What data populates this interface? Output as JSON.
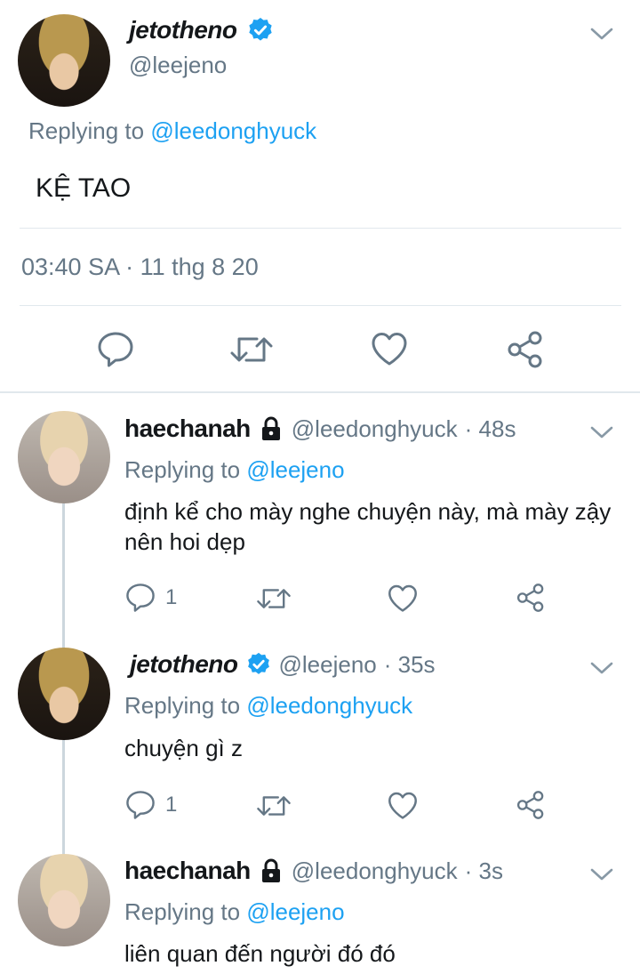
{
  "main_tweet": {
    "display_name": "jetotheno",
    "handle": "@leejeno",
    "replying_prefix": "Replying to",
    "replying_to": "@leedonghyuck",
    "text": "KỆ TAO",
    "timestamp": "03:40 SA · 11 thg 8 20"
  },
  "replies": [
    {
      "display_name": "haechanah",
      "handle": "@leedonghyuck",
      "time": "· 48s",
      "replying_prefix": "Replying to",
      "replying_to": "@leejeno",
      "text": "định kể cho mày nghe chuyện này, mà mày zậy nên hoi dẹp",
      "reply_count": "1"
    },
    {
      "display_name": "jetotheno",
      "handle": "@leejeno",
      "time": "· 35s",
      "replying_prefix": "Replying to",
      "replying_to": "@leedonghyuck",
      "text": "chuyện gì z",
      "reply_count": "1"
    },
    {
      "display_name": "haechanah",
      "handle": "@leedonghyuck",
      "time": "· 3s",
      "replying_prefix": "Replying to",
      "replying_to": "@leejeno",
      "text": "liên quan đến người đó đó"
    }
  ],
  "icons": {
    "verified": "verified-badge-icon",
    "lock": "lock-icon",
    "chevron": "chevron-down-icon",
    "reply": "reply-icon",
    "retweet": "retweet-icon",
    "like": "heart-icon",
    "share": "share-icon"
  },
  "colors": {
    "link": "#1da1f2",
    "muted": "#657786",
    "verified": "#1da1f2"
  }
}
